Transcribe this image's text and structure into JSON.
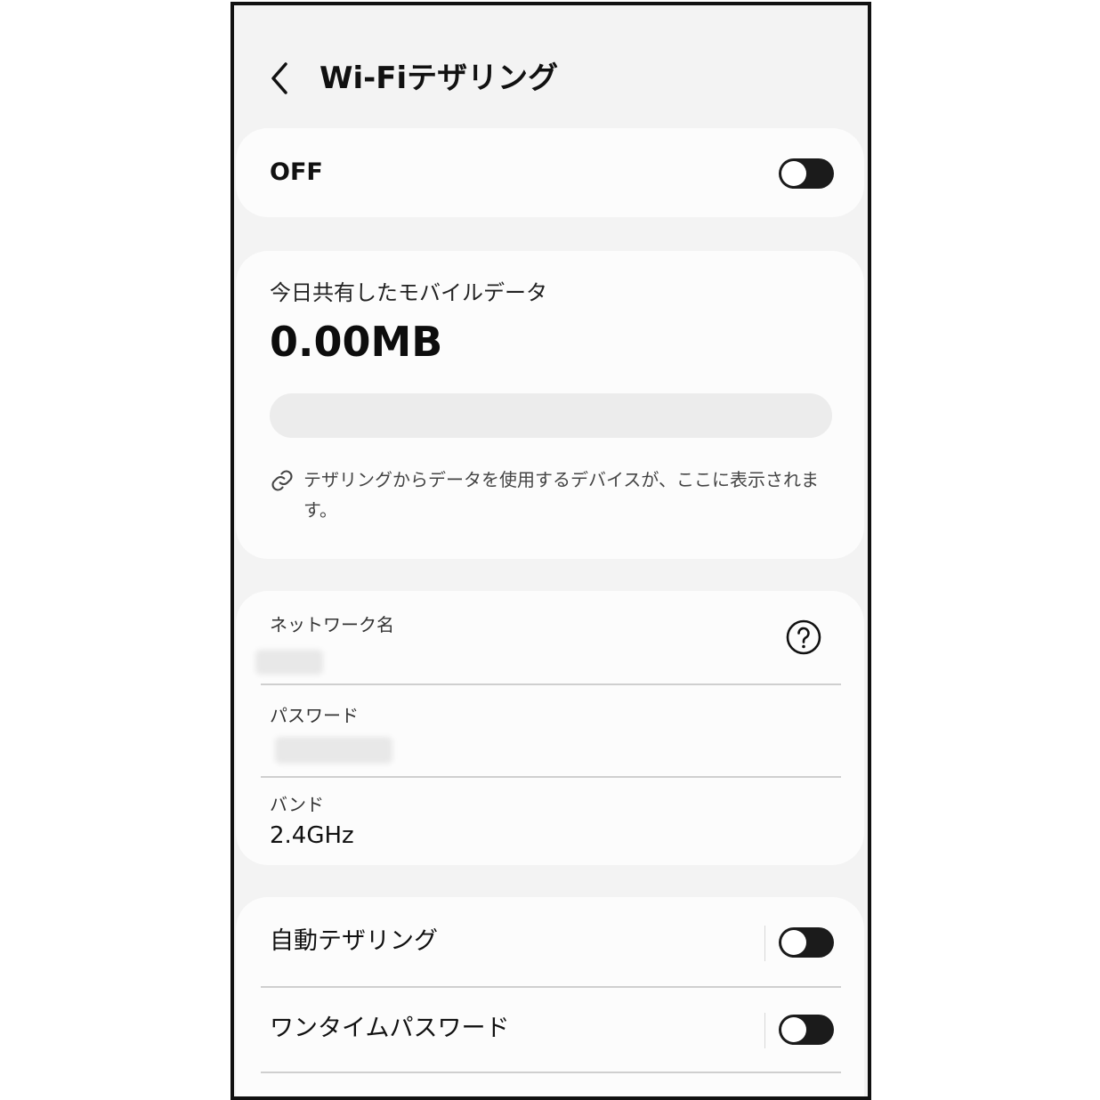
{
  "header": {
    "title": "Wi-Fiテザリング",
    "back_icon": "chevron-left-icon"
  },
  "main_switch": {
    "label": "OFF",
    "on": false
  },
  "data_usage": {
    "label": "今日共有したモバイルデータ",
    "value": "0.00MB",
    "link_icon": "link-icon",
    "note": "テザリングからデータを使用するデバイスが、ここに表示されます。"
  },
  "network": {
    "name_label": "ネットワーク名",
    "help_icon": "help-icon",
    "password_label": "パスワード",
    "band_label": "バンド",
    "band_value": "2.4GHz"
  },
  "settings": {
    "auto_tethering": {
      "label": "自動テザリング",
      "on": false
    },
    "one_time_password": {
      "label": "ワンタイムパスワード",
      "on": false
    }
  },
  "colors": {
    "background": "#f3f3f3",
    "card": "#fcfcfc",
    "toggle_off": "#1b1b1b",
    "text": "#111111"
  }
}
